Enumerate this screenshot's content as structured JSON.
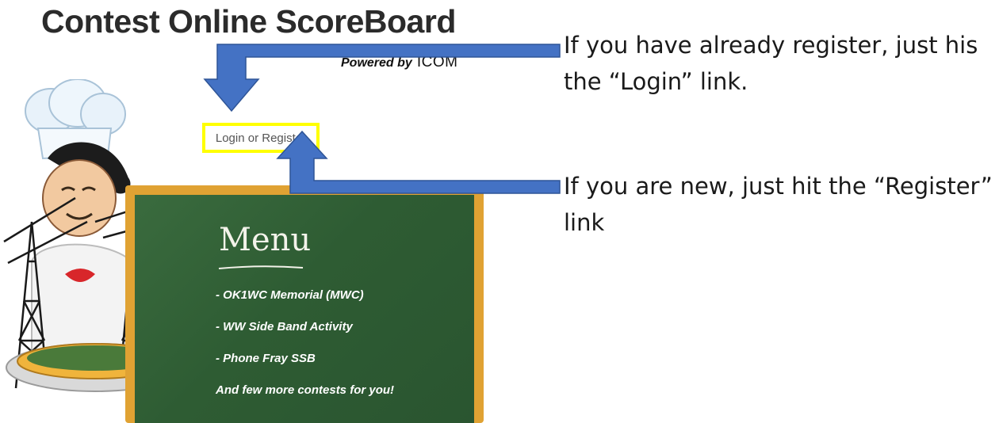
{
  "header": {
    "title": "Contest Online ScoreBoard",
    "powered_by": "Powered by",
    "brand": "ICOM"
  },
  "auth": {
    "link_label": "Login or Register"
  },
  "annotations": {
    "login_note": "If you have already register, just his the “Login” link.",
    "register_note": "If you are new, just hit the “Register” link"
  },
  "menu": {
    "title": "Menu",
    "items": [
      "- OK1WC Memorial (MWC)",
      "- WW Side Band Activity",
      "- Phone Fray SSB",
      "And few more contests for you!"
    ]
  },
  "colors": {
    "highlight": "#ffff00",
    "arrow": "#4472c4",
    "board_frame": "#e0a233",
    "board": "#2e5c33"
  }
}
